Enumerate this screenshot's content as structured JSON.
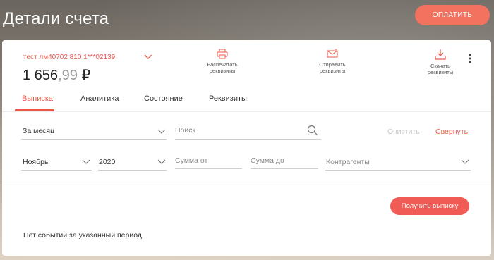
{
  "header": {
    "title": "Детали счета",
    "pay_button": "ОПЛАТИТЬ"
  },
  "account": {
    "name": "тест лм40702 810 1***02139",
    "balance_int": "1 656",
    "balance_dec": ",99",
    "currency": "₽"
  },
  "actions": [
    {
      "label_line1": "Распечатать",
      "label_line2": "реквизиты",
      "icon": "printer-icon"
    },
    {
      "label_line1": "Отправить",
      "label_line2": "реквизиты",
      "icon": "send-mail-icon"
    },
    {
      "label_line1": "Скачать",
      "label_line2": "реквизиты",
      "icon": "download-icon"
    }
  ],
  "tabs": [
    {
      "label": "Выписка",
      "active": true
    },
    {
      "label": "Аналитика",
      "active": false
    },
    {
      "label": "Состояние",
      "active": false
    },
    {
      "label": "Реквизиты",
      "active": false
    }
  ],
  "filters": {
    "period": "За месяц",
    "search_placeholder": "Поиск",
    "clear_label": "Очистить",
    "collapse_label": "Свернуть",
    "month": "Ноябрь",
    "year": "2020",
    "amount_from_placeholder": "Сумма от",
    "amount_to_placeholder": "Сумма до",
    "contractors_placeholder": "Контрагенты"
  },
  "statement": {
    "get_button": "Получить выписку",
    "empty_message": "Нет событий за указанный период"
  },
  "colors": {
    "accent": "#e9584b",
    "pay_button": "#f2715f"
  }
}
